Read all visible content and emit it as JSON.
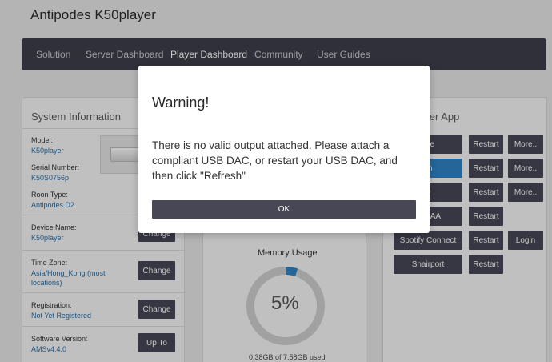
{
  "app": {
    "title": "Antipodes K50player"
  },
  "nav": {
    "items": [
      {
        "label": "Solution"
      },
      {
        "label": "Server Dashboard"
      },
      {
        "label": "Player Dashboard"
      },
      {
        "label": "Community"
      },
      {
        "label": "User Guides"
      }
    ],
    "active": "Player Dashboard"
  },
  "system": {
    "title": "System Information",
    "model_label": "Model:",
    "model_value": "K50player",
    "serial_label": "Serial Number:",
    "serial_value": "K50S0756p",
    "roon_label": "Roon Type:",
    "roon_value": "Antipodes D2",
    "device_label": "Device Name:",
    "device_value": "K50player",
    "device_btn": "Change",
    "tz_label": "Time Zone:",
    "tz_value_1": "Asia/Hong_Kong (most",
    "tz_value_2": "locations)",
    "tz_btn": "Change",
    "reg_label": "Registration:",
    "reg_value": "Not Yet Registered",
    "reg_btn": "Change",
    "sw_label": "Software Version:",
    "sw_value": "AMSv4.4.0",
    "sw_btn": "Up To"
  },
  "memory": {
    "title": "Memory Usage",
    "percent_text": "5%",
    "percent": 5,
    "used_text": "0.38GB of 7.58GB used"
  },
  "player_apps": {
    "title_fragment": "ayer App",
    "rows": [
      {
        "app": "eze",
        "restart": "Restart",
        "extra": "More.."
      },
      {
        "app": "on",
        "restart": "Restart",
        "extra": "More.."
      },
      {
        "app": "D",
        "restart": "Restart",
        "extra": "More.."
      },
      {
        "app": "er NAA",
        "restart": "Restart",
        "extra": ""
      },
      {
        "app": "Spotify Connect",
        "restart": "Restart",
        "extra": "Login"
      },
      {
        "app": "Shairport",
        "restart": "Restart",
        "extra": ""
      }
    ]
  },
  "modal": {
    "title": "Warning!",
    "message": "There is no valid output attached. Please attach a compliant USB DAC, or restart your USB DAC, and then click \"Refresh\"",
    "ok_label": "OK"
  },
  "colors": {
    "nav_bg": "#3e3e4b",
    "button_bg": "#474756",
    "link": "#2a6ea8",
    "active_app": "#2f83c6",
    "gauge_fill": "#2f83c6",
    "gauge_track": "#cfcfcf"
  }
}
